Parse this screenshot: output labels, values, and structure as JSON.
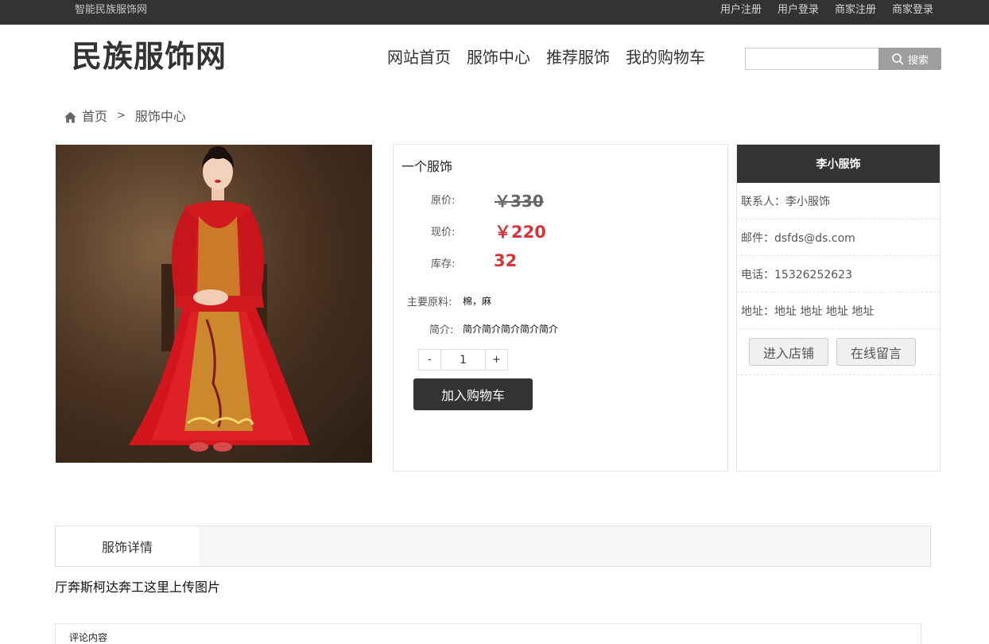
{
  "topbar": {
    "site_name": "智能民族服饰网",
    "links": [
      "用户注册",
      "用户登录",
      "商家注册",
      "商家登录"
    ]
  },
  "header": {
    "logo": "民族服饰网",
    "nav": [
      "网站首页",
      "服饰中心",
      "推荐服饰",
      "我的购物车"
    ],
    "search": {
      "value": "",
      "placeholder": "",
      "button_label": "搜索"
    }
  },
  "breadcrumb": {
    "home": "首页",
    "separator": ">",
    "current": "服饰中心"
  },
  "product": {
    "name": "一个服饰",
    "original_price_label": "原价:",
    "original_price": "￥330",
    "current_price_label": "现价:",
    "current_price": "￥220",
    "stock_label": "库存:",
    "stock": "32",
    "material_label": "主要原料:",
    "material": "棉，麻",
    "intro_label": "简介:",
    "intro": "简介简介简介简介简介",
    "qty_minus": "-",
    "qty_value": "1",
    "qty_plus": "+",
    "add_to_cart": "加入购物车"
  },
  "shop": {
    "name": "李小服饰",
    "contact": "联系人：李小服饰",
    "email": "邮件：dsfds@ds.com",
    "phone": "电话：15326252623",
    "address": "地址：地址 地址 地址 地址",
    "enter_shop": "进入店铺",
    "message": "在线留言"
  },
  "tabs": {
    "detail": "服饰详情"
  },
  "detail_text": "厅奔斯柯达奔工这里上传图片",
  "comments": {
    "title": "评论内容"
  },
  "colors": {
    "dark": "#333333",
    "price_red": "#d9333a",
    "search_button": "#9e9e9e"
  }
}
